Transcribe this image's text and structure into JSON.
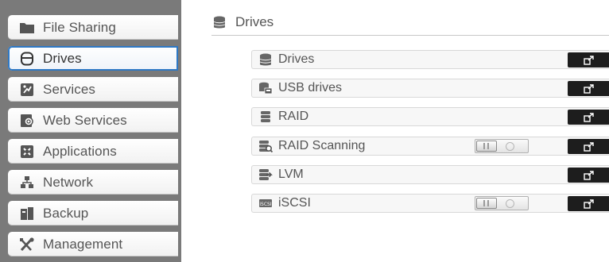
{
  "sidebar": {
    "items": [
      {
        "label": "File Sharing",
        "icon": "folder-icon",
        "active": false
      },
      {
        "label": "Drives",
        "icon": "drive-icon",
        "active": true
      },
      {
        "label": "Services",
        "icon": "services-icon",
        "active": false
      },
      {
        "label": "Web Services",
        "icon": "web-services-icon",
        "active": false
      },
      {
        "label": "Applications",
        "icon": "applications-icon",
        "active": false
      },
      {
        "label": "Network",
        "icon": "network-icon",
        "active": false
      },
      {
        "label": "Backup",
        "icon": "backup-icon",
        "active": false
      },
      {
        "label": "Management",
        "icon": "tools-icon",
        "active": false
      }
    ]
  },
  "header": {
    "title": "Drives",
    "icon": "drive-stack-icon"
  },
  "rows": [
    {
      "label": "Drives",
      "icon": "drive-stack-icon",
      "toggle": null
    },
    {
      "label": "USB drives",
      "icon": "usb-drive-icon",
      "toggle": null
    },
    {
      "label": "RAID",
      "icon": "raid-icon",
      "toggle": null
    },
    {
      "label": "RAID Scanning",
      "icon": "raid-scan-icon",
      "toggle": "off"
    },
    {
      "label": "LVM",
      "icon": "lvm-icon",
      "toggle": null
    },
    {
      "label": "iSCSI",
      "icon": "iscsi-icon",
      "toggle": "off"
    }
  ],
  "colors": {
    "sidebar_bg": "#7a7a7a",
    "active_border": "#2d78c5",
    "button_bg": "#1d1d1d",
    "icon_color": "#555555"
  }
}
